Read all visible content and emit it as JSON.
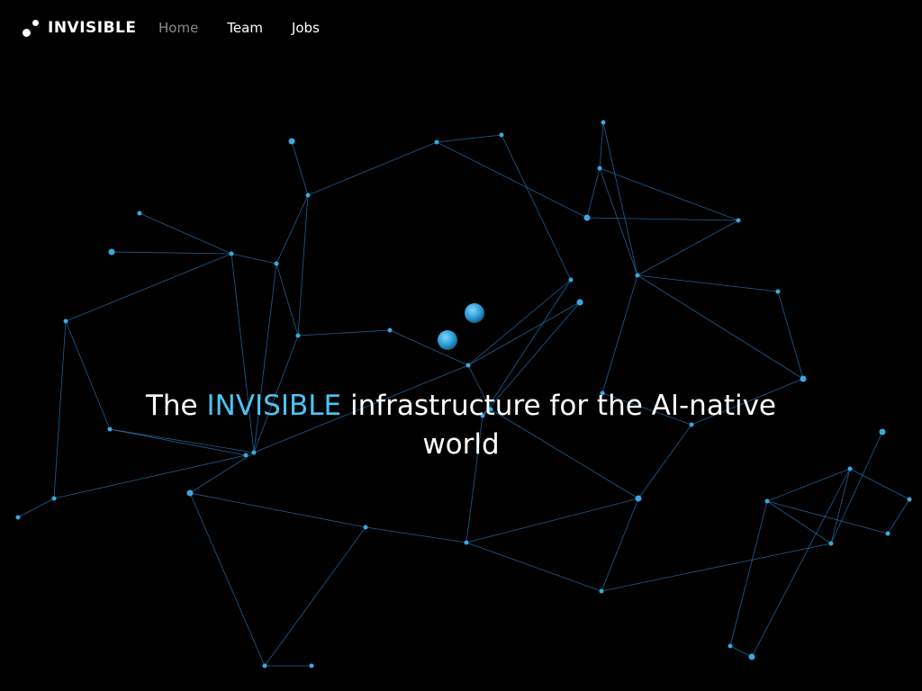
{
  "brand": {
    "name": "INVISIBLE"
  },
  "nav": {
    "items": [
      {
        "label": "Home",
        "active": true
      },
      {
        "label": "Team",
        "active": false
      },
      {
        "label": "Jobs",
        "active": false
      }
    ]
  },
  "hero": {
    "prefix": "The",
    "highlight": "INVISIBLE",
    "suffix": "infrastructure for the AI-native world"
  },
  "colors": {
    "background": "#000000",
    "accent": "#4cc3f5",
    "node": "#3aa8e0",
    "line": "#2a7fc0",
    "nav_inactive": "#8a8a8a"
  }
}
